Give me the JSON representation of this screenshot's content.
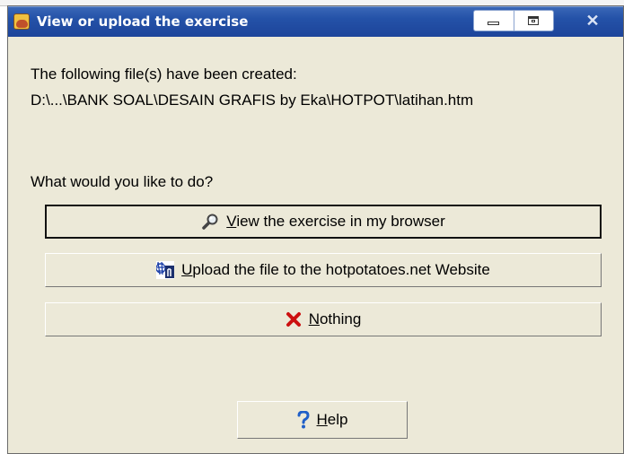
{
  "window": {
    "title": "View or upload the exercise"
  },
  "message": {
    "line1": "The following file(s) have been created:",
    "path": "D:\\...\\BANK SOAL\\DESAIN GRAFIS by Eka\\HOTPOT\\latihan.htm",
    "question": "What would you like to do?"
  },
  "buttons": {
    "view": {
      "mnemonic": "V",
      "rest": "iew the exercise in my browser",
      "icon": "magnifier-icon"
    },
    "upload": {
      "mnemonic": "U",
      "rest": "pload the file to the hotpotatoes.net Website",
      "icon": "web-upload-icon"
    },
    "nothing": {
      "mnemonic": "N",
      "rest": "othing",
      "icon": "red-x-icon"
    },
    "help": {
      "mnemonic": "H",
      "rest": "elp",
      "icon": "question-icon"
    }
  },
  "colors": {
    "titlebar": "#1d449a",
    "dialog_bg": "#ece9d8",
    "close_icon": "#cc1010",
    "help_icon": "#1f5fc8"
  }
}
